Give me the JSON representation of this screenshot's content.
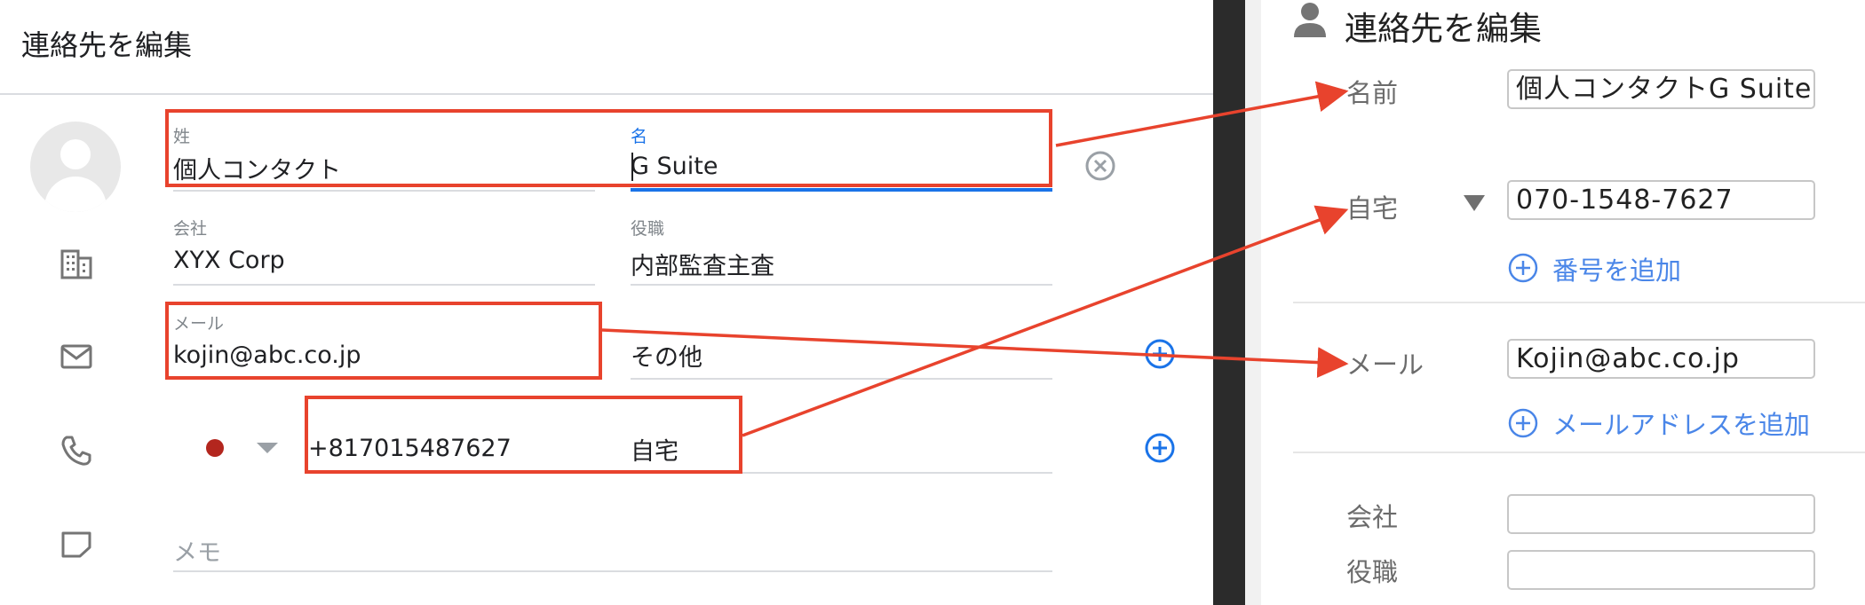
{
  "left": {
    "title": "連絡先を編集",
    "last_name": {
      "label": "姓",
      "value": "個人コンタクト"
    },
    "first_name": {
      "label": "名",
      "value": "G Suite"
    },
    "company": {
      "label": "会社",
      "value": "XYX Corp"
    },
    "job_title": {
      "label": "役職",
      "value": "内部監査主査"
    },
    "email": {
      "label": "メール",
      "value": "kojin@abc.co.jp",
      "type": "その他"
    },
    "phone": {
      "value": "+817015487627",
      "type": "自宅"
    },
    "memo": {
      "placeholder": "メモ"
    }
  },
  "right": {
    "title": "連絡先を編集",
    "name_label": "名前",
    "name_value": "個人コンタクトG Suite",
    "phone_label": "自宅",
    "phone_value": "070-1548-7627",
    "add_phone": "番号を追加",
    "email_label": "メール",
    "email_value": "Kojin@abc.co.jp",
    "add_email": "メールアドレスを追加",
    "company_label": "会社",
    "company_value": "",
    "job_title_label": "役職",
    "job_title_value": ""
  },
  "colors": {
    "annotation_red": "#e8432d",
    "accent_blue": "#1a73e8",
    "link_blue": "#4a86e8",
    "flag_red": "#b3261e"
  },
  "icons": {
    "avatar": "avatar-icon",
    "building": "building-icon",
    "mail": "mail-icon",
    "phone": "phone-icon",
    "note": "note-icon",
    "clear": "clear-icon",
    "add": "add-circle-icon",
    "person": "person-icon",
    "dropdown": "dropdown-arrow-icon"
  }
}
